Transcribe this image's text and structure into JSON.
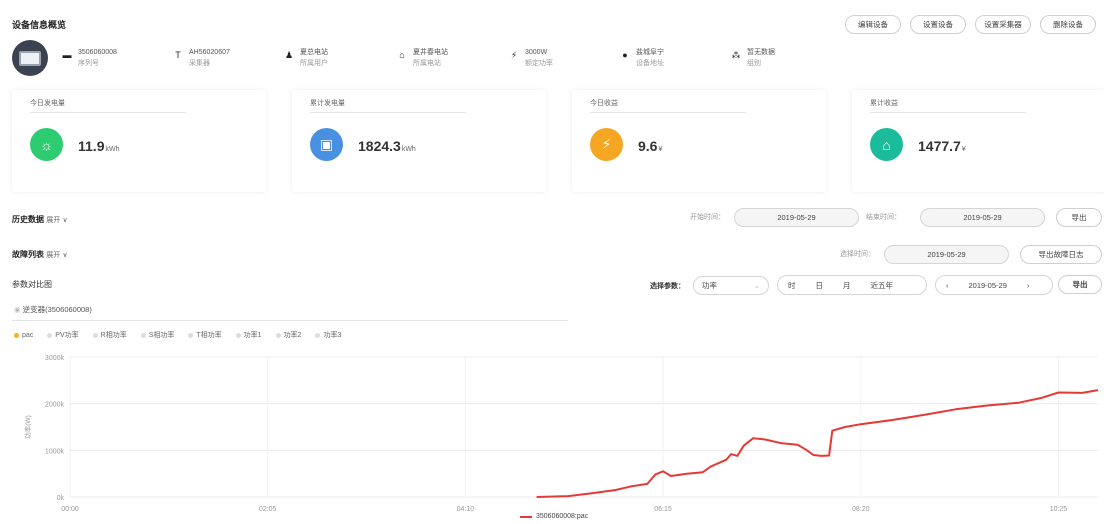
{
  "header": {
    "title": "设备信息概览",
    "buttons": [
      "编辑设备",
      "设置设备",
      "设置采集器",
      "删除设备"
    ]
  },
  "info": [
    {
      "icon": "card-icon",
      "glyph": "▬",
      "value": "3506060008",
      "label": "序列号"
    },
    {
      "icon": "collector-icon",
      "glyph": "T",
      "value": "AH56020607",
      "label": "采集器"
    },
    {
      "icon": "user-icon",
      "glyph": "♟",
      "value": "夏总电站",
      "label": "所属用户"
    },
    {
      "icon": "house-icon",
      "glyph": "⌂",
      "value": "夏井春电站",
      "label": "所属电站"
    },
    {
      "icon": "bolt-icon",
      "glyph": "⚡",
      "value": "3000W",
      "label": "额定功率"
    },
    {
      "icon": "location-icon",
      "glyph": "●",
      "value": "盐城阜宁",
      "label": "设备地址"
    },
    {
      "icon": "network-icon",
      "glyph": "⁂",
      "value": "暂无数据",
      "label": "组别"
    }
  ],
  "stats": [
    {
      "label": "今日发电量",
      "value": "11.9",
      "unit": "kWh",
      "color": "#2ecc71",
      "glyph": "☼",
      "icon": "sun-icon"
    },
    {
      "label": "累计发电量",
      "value": "1824.3",
      "unit": "kWh",
      "color": "#4a90e2",
      "glyph": "▣",
      "icon": "battery-icon"
    },
    {
      "label": "今日收益",
      "value": "9.6",
      "unit": "¥",
      "color": "#f5a623",
      "glyph": "⚡",
      "icon": "tower-icon"
    },
    {
      "label": "累计收益",
      "value": "1477.7",
      "unit": "¥",
      "color": "#1abc9c",
      "glyph": "⌂",
      "icon": "plant-icon"
    }
  ],
  "history": {
    "title": "历史数据",
    "expand": "展开",
    "start_label": "开始时间：",
    "start": "2019-05-29",
    "end_label": "结束时间：",
    "end": "2019-05-29",
    "export": "导出"
  },
  "faults": {
    "title": "故障列表",
    "expand": "展开",
    "select_label": "选择时间：",
    "date": "2019-05-29",
    "export": "导出故障日志"
  },
  "compare": {
    "title": "参数对比图",
    "param_label": "选择参数：",
    "param_value": "功率",
    "periods": [
      "时",
      "日",
      "月",
      "近五年"
    ],
    "prev": "‹",
    "date": "2019-05-29",
    "next": "›",
    "export": "导出",
    "device_tab": "逆变器(3506060008)",
    "legend": [
      "pac",
      "PV功率",
      "R相功率",
      "S相功率",
      "T相功率",
      "功率1",
      "功率2",
      "功率3"
    ]
  },
  "chart_data": {
    "type": "line",
    "ylabel": "功率(W)",
    "y_ticks": [
      "0k",
      "1000k",
      "2000k",
      "3000k"
    ],
    "ylim": [
      0,
      3000
    ],
    "x_ticks": [
      "00:00",
      "02:05",
      "04:10",
      "06:15",
      "08:20",
      "10:25"
    ],
    "series": [
      {
        "name": "3506060008:pac",
        "color": "#e53935",
        "points": [
          [
            "04:55",
            0
          ],
          [
            "05:15",
            20
          ],
          [
            "05:30",
            80
          ],
          [
            "05:45",
            150
          ],
          [
            "05:55",
            230
          ],
          [
            "06:05",
            280
          ],
          [
            "06:10",
            480
          ],
          [
            "06:15",
            550
          ],
          [
            "06:20",
            450
          ],
          [
            "06:30",
            500
          ],
          [
            "06:40",
            530
          ],
          [
            "06:45",
            650
          ],
          [
            "06:55",
            800
          ],
          [
            "06:58",
            920
          ],
          [
            "07:02",
            880
          ],
          [
            "07:06",
            1100
          ],
          [
            "07:12",
            1260
          ],
          [
            "07:20",
            1230
          ],
          [
            "07:30",
            1150
          ],
          [
            "07:40",
            1120
          ],
          [
            "07:46",
            1000
          ],
          [
            "07:50",
            900
          ],
          [
            "07:55",
            880
          ],
          [
            "08:00",
            890
          ],
          [
            "08:02",
            1420
          ],
          [
            "08:10",
            1500
          ],
          [
            "08:20",
            1560
          ],
          [
            "08:40",
            1650
          ],
          [
            "09:00",
            1760
          ],
          [
            "09:20",
            1880
          ],
          [
            "09:40",
            1960
          ],
          [
            "10:00",
            2020
          ],
          [
            "10:15",
            2130
          ],
          [
            "10:25",
            2240
          ],
          [
            "10:40",
            2230
          ],
          [
            "10:50",
            2290
          ]
        ]
      }
    ]
  }
}
